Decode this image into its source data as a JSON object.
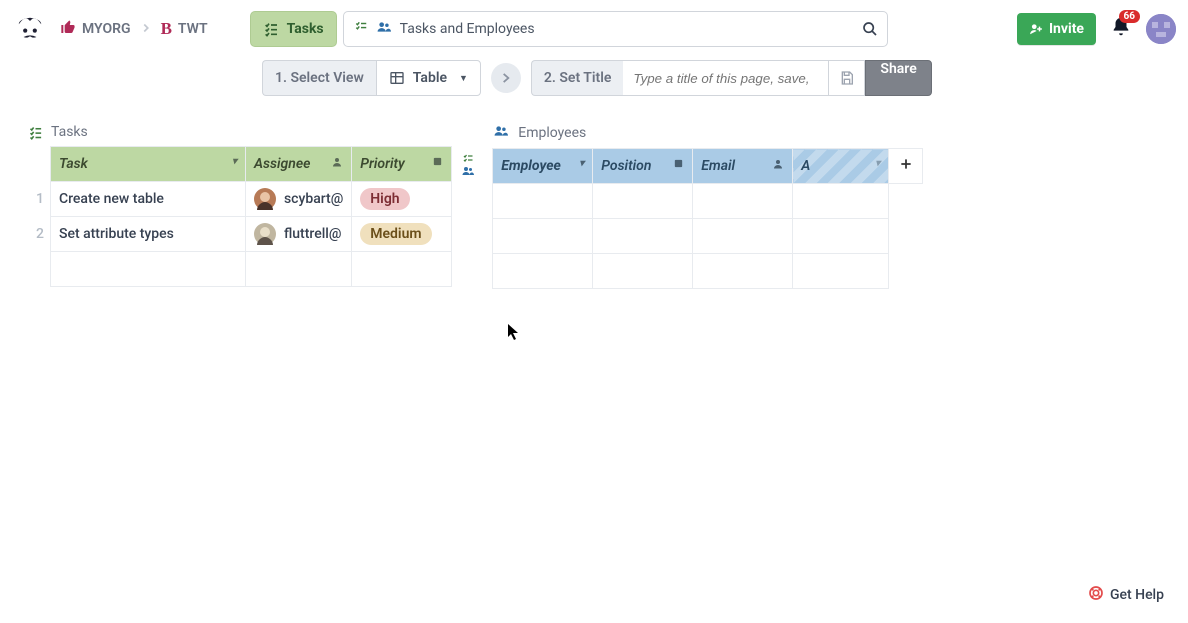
{
  "breadcrumb": {
    "org": "MYORG",
    "project": "TWT"
  },
  "tabs": {
    "tasks_label": "Tasks",
    "search_label": "Tasks and Employees"
  },
  "toolbar": {
    "step1": "1. Select View",
    "table_label": "Table",
    "step2": "2. Set Title",
    "title_placeholder": "Type a title of this page, save,",
    "share_label": "Share"
  },
  "right": {
    "invite_label": "Invite",
    "notif_count": "66"
  },
  "tables": {
    "tasks": {
      "caption": "Tasks",
      "columns": [
        "Task",
        "Assignee",
        "Priority"
      ],
      "rows": [
        {
          "n": "1",
          "task": "Create new table",
          "assignee": "scybart@",
          "priority": "High",
          "plevel": "high"
        },
        {
          "n": "2",
          "task": "Set attribute types",
          "assignee": "fluttrell@",
          "priority": "Medium",
          "plevel": "med"
        }
      ]
    },
    "employees": {
      "caption": "Employees",
      "columns": [
        "Employee",
        "Position",
        "Email",
        "A"
      ]
    }
  },
  "help_label": "Get Help"
}
